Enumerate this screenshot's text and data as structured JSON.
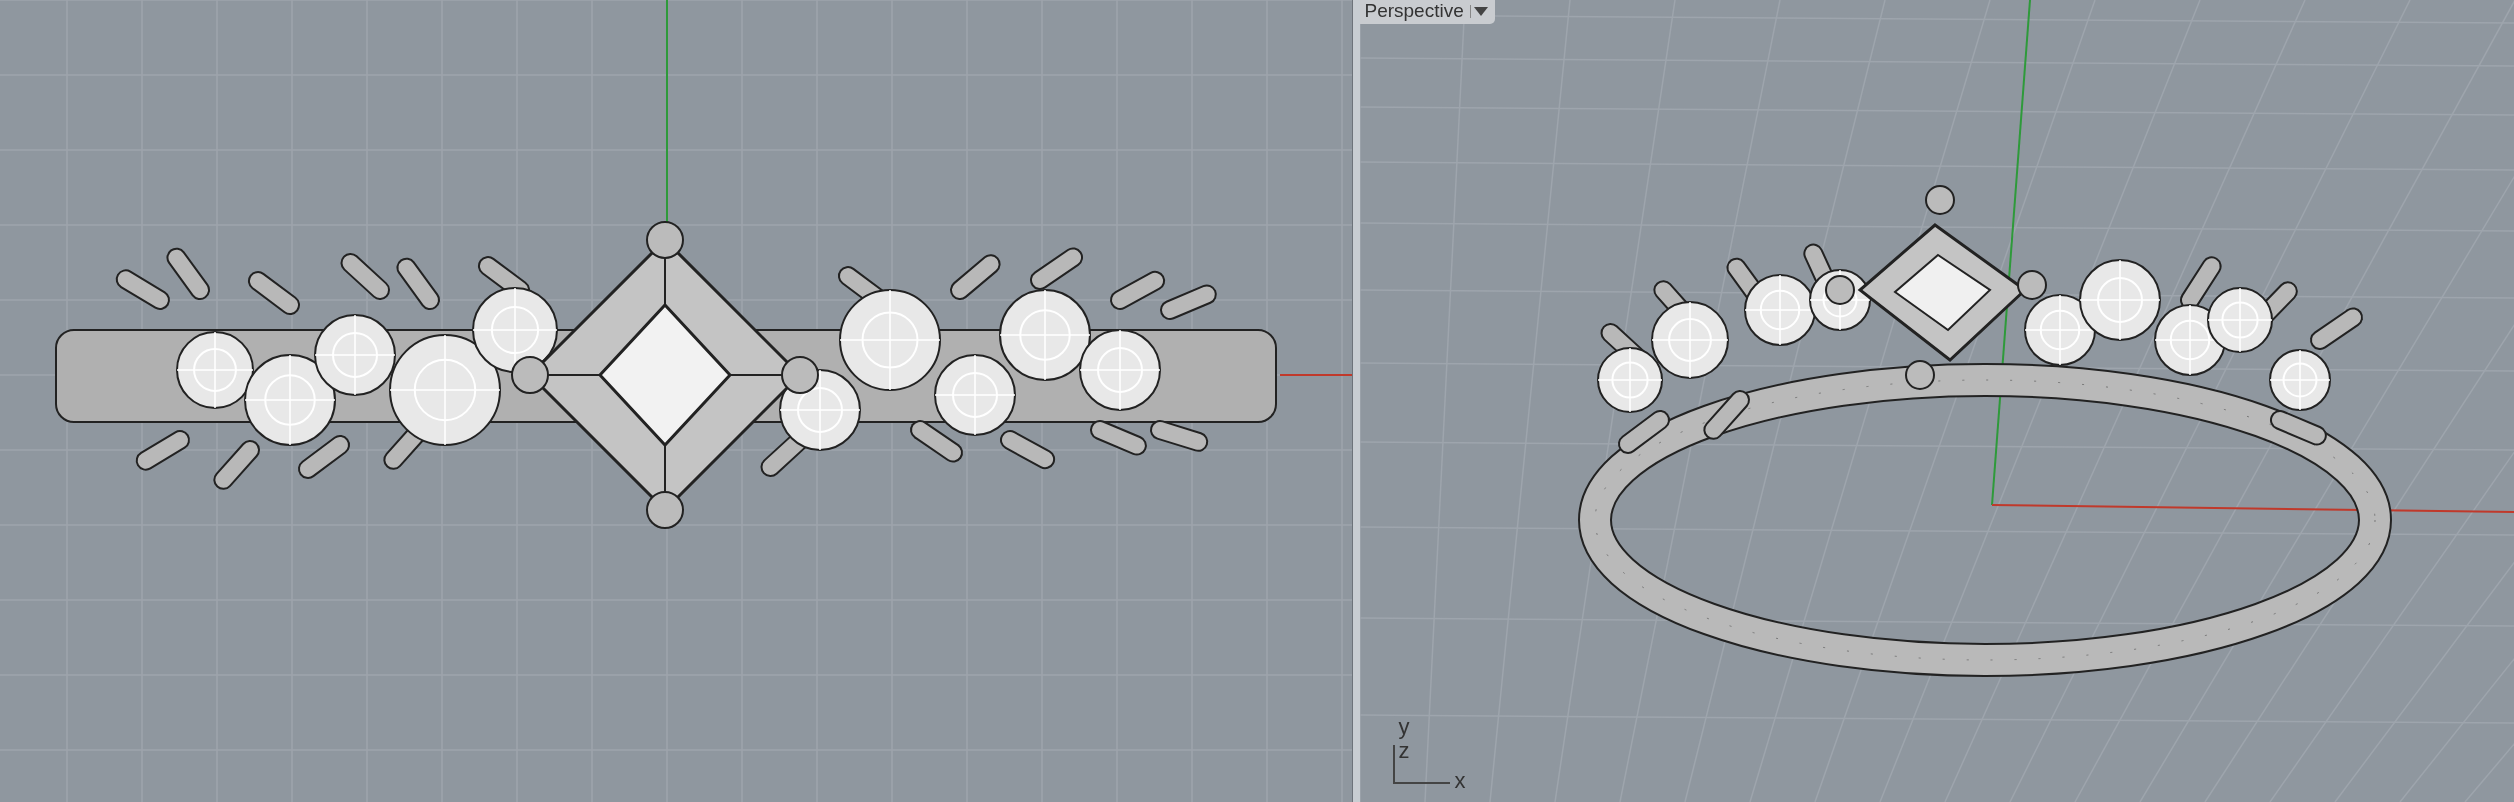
{
  "viewports": [
    {
      "kind": "front"
    },
    {
      "kind": "perspective",
      "title": "Perspective",
      "axes": {
        "y": "y",
        "z": "z",
        "x": "x"
      }
    }
  ]
}
